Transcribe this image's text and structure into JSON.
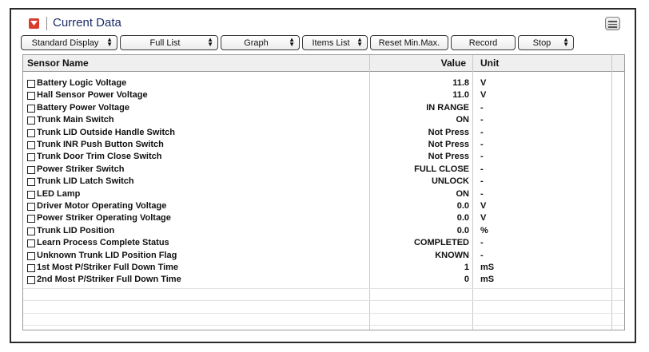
{
  "window": {
    "title": "Current Data",
    "menu_icon": "list-menu-icon",
    "title_icon": "collapse-arrow-icon"
  },
  "toolbar": {
    "buttons": [
      {
        "label": "Standard Display",
        "has_spinner": true
      },
      {
        "label": "Full List",
        "has_spinner": true
      },
      {
        "label": "Graph",
        "has_spinner": true
      },
      {
        "label": "Items List",
        "has_spinner": true
      },
      {
        "label": "Reset Min.Max.",
        "has_spinner": false
      },
      {
        "label": "Record",
        "has_spinner": false
      },
      {
        "label": "Stop",
        "has_spinner": true
      }
    ]
  },
  "table": {
    "columns": {
      "name": "Sensor Name",
      "value": "Value",
      "unit": "Unit"
    },
    "rows": [
      {
        "name": "Battery Logic Voltage",
        "value": "11.8",
        "unit": "V"
      },
      {
        "name": "Hall Sensor Power Voltage",
        "value": "11.0",
        "unit": "V"
      },
      {
        "name": "Battery Power Voltage",
        "value": "IN RANGE",
        "unit": "-"
      },
      {
        "name": "Trunk Main Switch",
        "value": "ON",
        "unit": "-"
      },
      {
        "name": "Trunk LID Outside Handle Switch",
        "value": "Not Press",
        "unit": "-"
      },
      {
        "name": "Trunk INR Push Button Switch",
        "value": "Not Press",
        "unit": "-"
      },
      {
        "name": "Trunk Door Trim Close Switch",
        "value": "Not Press",
        "unit": "-"
      },
      {
        "name": "Power Striker Switch",
        "value": "FULL CLOSE",
        "unit": "-"
      },
      {
        "name": "Trunk LID Latch Switch",
        "value": "UNLOCK",
        "unit": "-"
      },
      {
        "name": "LED Lamp",
        "value": "ON",
        "unit": "-"
      },
      {
        "name": "Driver Motor Operating Voltage",
        "value": "0.0",
        "unit": "V"
      },
      {
        "name": "Power Striker Operating Voltage",
        "value": "0.0",
        "unit": "V"
      },
      {
        "name": "Trunk LID Position",
        "value": "0.0",
        "unit": "%"
      },
      {
        "name": "Learn Process Complete Status",
        "value": "COMPLETED",
        "unit": "-"
      },
      {
        "name": "Unknown Trunk LID Position Flag",
        "value": "KNOWN",
        "unit": "-"
      },
      {
        "name": "1st Most P/Striker Full Down Time",
        "value": "1",
        "unit": "mS"
      },
      {
        "name": "2nd Most P/Striker Full Down Time",
        "value": "0",
        "unit": "mS"
      }
    ]
  }
}
